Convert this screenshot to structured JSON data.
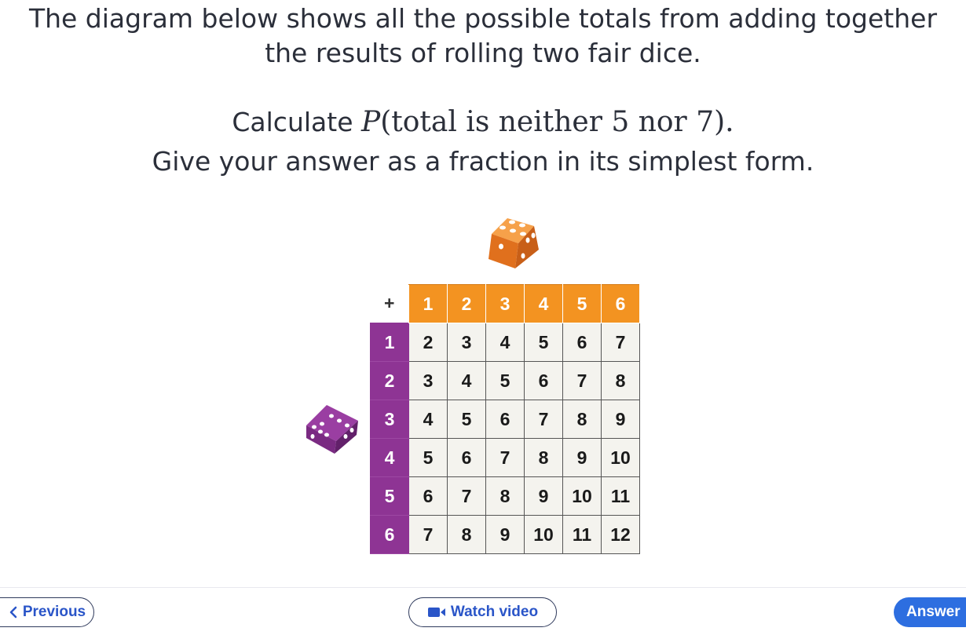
{
  "intro": {
    "line1": "The diagram below shows all the possible totals from adding together",
    "line2": "the results of rolling two fair dice."
  },
  "question": {
    "prefix": "Calculate ",
    "math_var": "P",
    "math_rest": "(total is neither 5 nor 7).",
    "instruction": "Give your answer as a fraction in its simplest form."
  },
  "table": {
    "corner": "+",
    "col_headers": [
      "1",
      "2",
      "3",
      "4",
      "5",
      "6"
    ],
    "rows": [
      {
        "head": "1",
        "cells": [
          "2",
          "3",
          "4",
          "5",
          "6",
          "7"
        ]
      },
      {
        "head": "2",
        "cells": [
          "3",
          "4",
          "5",
          "6",
          "7",
          "8"
        ]
      },
      {
        "head": "3",
        "cells": [
          "4",
          "5",
          "6",
          "7",
          "8",
          "9"
        ]
      },
      {
        "head": "4",
        "cells": [
          "5",
          "6",
          "7",
          "8",
          "9",
          "10"
        ]
      },
      {
        "head": "5",
        "cells": [
          "6",
          "7",
          "8",
          "9",
          "10",
          "11"
        ]
      },
      {
        "head": "6",
        "cells": [
          "7",
          "8",
          "9",
          "10",
          "11",
          "12"
        ]
      }
    ]
  },
  "colors": {
    "orange": "#f39321",
    "purple": "#8e3494",
    "accent_blue": "#2d6ee0"
  },
  "icons": {
    "orange_die": "orange-die-icon",
    "purple_die": "purple-die-icon",
    "previous": "chevron-left-icon",
    "video": "video-camera-icon"
  },
  "nav": {
    "previous_label": "Previous",
    "video_label": "Watch video",
    "answer_label": "Answer"
  }
}
